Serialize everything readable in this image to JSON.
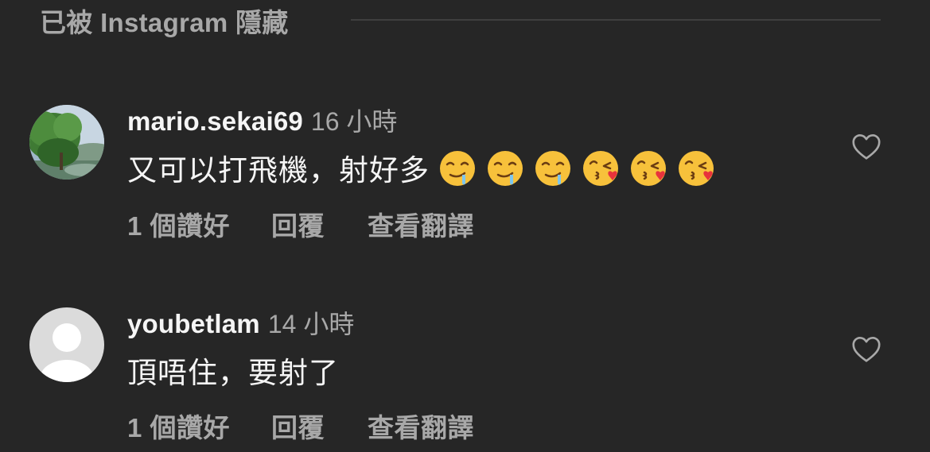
{
  "hidden_section": {
    "label": "已被 Instagram 隱藏"
  },
  "comments": [
    {
      "username": "mario.sekai69",
      "time": "16 小時",
      "text": "又可以打飛機，射好多",
      "emojis": [
        "drooling-face",
        "drooling-face",
        "drooling-face",
        "face-blowing-kiss",
        "face-blowing-kiss",
        "face-blowing-kiss"
      ],
      "likes": "1 個讚好",
      "reply": "回覆",
      "translate": "查看翻譯",
      "avatar": "landscape-photo"
    },
    {
      "username": "youbetlam",
      "time": "14 小時",
      "text": "頂唔住，要射了",
      "emojis": [],
      "likes": "1 個讚好",
      "reply": "回覆",
      "translate": "查看翻譯",
      "avatar": "default-profile"
    }
  ],
  "colors": {
    "background": "#262626",
    "primary_text": "#f5f5f5",
    "secondary_text": "#a8a8a8",
    "divider": "#3f3f3f"
  }
}
